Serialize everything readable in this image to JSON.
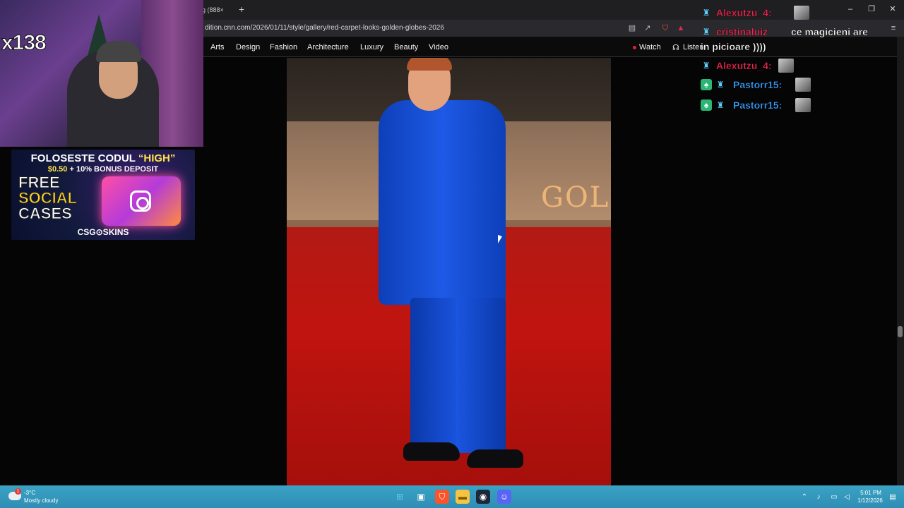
{
  "browser": {
    "tab_title": "g (888×",
    "new_tab_symbol": "+",
    "url": "dition.cnn.com/2026/01/11/style/gallery/red-carpet-looks-golden-globes-2026",
    "window_controls": {
      "minimize": "–",
      "restore": "❐",
      "close": "✕"
    }
  },
  "site_nav": {
    "items": [
      "Arts",
      "Design",
      "Fashion",
      "Architecture",
      "Luxury",
      "Beauty",
      "Video"
    ],
    "watch": "Watch",
    "listen": "Listen"
  },
  "photo": {
    "backdrop_text": "GOLDE"
  },
  "webcam": {
    "multiplier": "x138"
  },
  "ad": {
    "line1_prefix": "FOLOSESTE CODUL ",
    "line1_code": "“HIGH”",
    "line2_amount": "$0.50",
    "line2_rest": " + 10% BONUS DEPOSIT",
    "free": "FREE",
    "social": "SOCIAL",
    "cases": "CASES",
    "brand": "CSG⊙SKINS"
  },
  "chat": {
    "rows": [
      {
        "name": "Alexutzu_4:",
        "color": "#e8284f"
      },
      {
        "name": "cristinaluiz",
        "color": "#e8284f"
      },
      {
        "name": "Alexutzu_4:",
        "color": "#e8284f"
      },
      {
        "name": "Pastorr15:",
        "color": "#3aa0ff"
      },
      {
        "name": "Pastorr15:",
        "color": "#3aa0ff"
      }
    ],
    "message_line1": "ce magicieni are",
    "message_line2": "in picioare ))))"
  },
  "taskbar": {
    "weather_temp": "-3°C",
    "weather_desc": "Mostly cloudy",
    "weather_alert": "1",
    "clock_time": "5:01 PM",
    "clock_date": "1/12/2026"
  }
}
